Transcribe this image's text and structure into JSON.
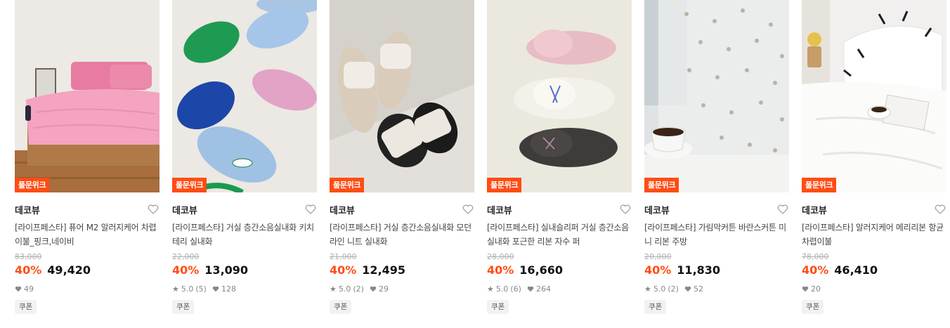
{
  "badge_label": "풀문위크",
  "coupon_label": "쿠폰",
  "accent_color": "#ff4d14",
  "products": [
    {
      "brand": "데코뷰",
      "title": "[라이프페스타] 퓨어 M2 알러지케어 차렵이불_핑크,네이비",
      "original_price": "83,000",
      "discount": "40%",
      "price": "49,420",
      "rating": "",
      "reviews": "",
      "likes": "49"
    },
    {
      "brand": "데코뷰",
      "title": "[라이프페스타] 거실 층간소음실내화 키치 테리 실내화",
      "original_price": "22,000",
      "discount": "40%",
      "price": "13,090",
      "rating": "5.0",
      "reviews": "(5)",
      "likes": "128"
    },
    {
      "brand": "데코뷰",
      "title": "[라이프페스타] 거실 층간소음실내화 모던 라인 니트 실내화",
      "original_price": "21,000",
      "discount": "40%",
      "price": "12,495",
      "rating": "5.0",
      "reviews": "(2)",
      "likes": "29"
    },
    {
      "brand": "데코뷰",
      "title": "[라이프페스타] 실내슬리퍼 거실 층간소음실내화 포근한 리본 자수 퍼",
      "original_price": "28,000",
      "discount": "40%",
      "price": "16,660",
      "rating": "5.0",
      "reviews": "(6)",
      "likes": "264"
    },
    {
      "brand": "데코뷰",
      "title": "[라이프페스타] 가림막커튼 바란스커튼 미니 리본 주방",
      "original_price": "20,000",
      "discount": "40%",
      "price": "11,830",
      "rating": "5.0",
      "reviews": "(2)",
      "likes": "52"
    },
    {
      "brand": "데코뷰",
      "title": "[라이프페스타] 알러지케어 메리리본 항균 차렵이불",
      "original_price": "78,000",
      "discount": "40%",
      "price": "46,410",
      "rating": "",
      "reviews": "",
      "likes": "20"
    }
  ]
}
